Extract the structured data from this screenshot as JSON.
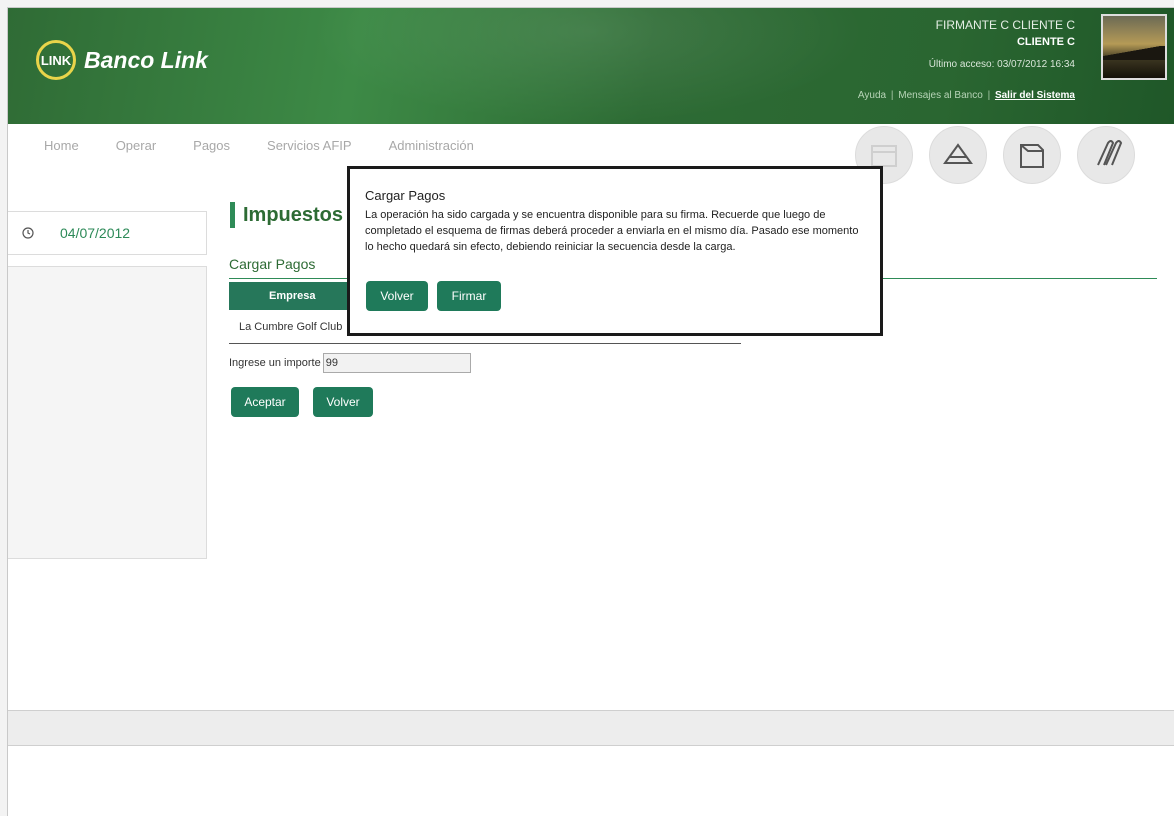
{
  "header": {
    "logo_mark": "LINK",
    "bank_name": "Banco Link",
    "user_name": "FIRMANTE C CLIENTE C",
    "client_name": "CLIENTE C",
    "last_access": "Último acceso: 03/07/2012 16:34",
    "links": {
      "help": "Ayuda",
      "messages": "Mensajes al Banco",
      "logout": "Salir del Sistema"
    }
  },
  "nav": {
    "items": [
      "Home",
      "Operar",
      "Pagos",
      "Servicios AFIP",
      "Administración"
    ]
  },
  "sidebar": {
    "date": "04/07/2012"
  },
  "main": {
    "title": "Impuestos",
    "subtitle": "Cargar Pagos",
    "table": {
      "headers": [
        "Empresa"
      ],
      "row": {
        "company": "La Cumbre Golf Club"
      }
    },
    "amount_label": "Ingrese un importe",
    "amount_value": "99",
    "accept_button": "Aceptar",
    "back_button": "Volver"
  },
  "modal": {
    "title": "Cargar Pagos",
    "body": "La operación ha sido cargada y se encuentra disponible para su firma. Recuerde que luego de completado el esquema de firmas deberá proceder a enviarla en el mismo día. Pasado ese momento lo hecho quedará sin efecto, debiendo reiniciar la secuencia desde la carga.",
    "back_button": "Volver",
    "sign_button": "Firmar"
  },
  "colors": {
    "brand_green": "#2d6b34",
    "button_green": "#1f7a5a",
    "logo_yellow": "#e9d44a"
  },
  "icons": [
    "clock-icon",
    "calendar-icon",
    "envelope-icon",
    "folder-icon",
    "paperclip-icon"
  ]
}
